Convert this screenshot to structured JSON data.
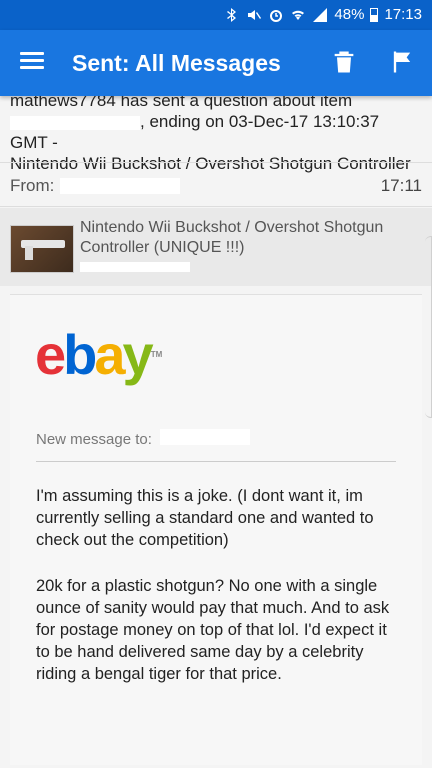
{
  "status_bar": {
    "battery_text": "48%",
    "battery_level": 0.48,
    "time": "17:13"
  },
  "app_bar": {
    "title": "Sent: All Messages"
  },
  "message": {
    "subject_partial_top": "mathews7784 has sent a question about item",
    "subject_partial_mid": ", ending on 03-Dec-17 13:10:37 GMT -",
    "subject_line_3": "Nintendo Wii Buckshot / Overshot Shotgun Controller",
    "from_label": "From:",
    "time": "17:11",
    "item_title": "Nintendo Wii Buckshot / Overshot Shotgun Controller (UNIQUE !!!)",
    "new_message_label": "New message to:",
    "body_paragraph_1": "I'm assuming this is a joke. (I dont want it, im currently selling a standard one and wanted to check out the competition)",
    "body_paragraph_2": "20k for a plastic shotgun? No one with a single ounce of sanity would pay that much. And to ask for postage money on top of that lol. I'd expect it to be hand delivered same day by a celebrity riding a bengal tiger for that price."
  },
  "ebay_logo": {
    "e": "e",
    "b": "b",
    "a": "a",
    "y": "y",
    "tm": "TM"
  },
  "icons": {
    "menu": "hamburger-icon",
    "trash": "trash-icon",
    "flag": "flag-icon"
  },
  "colors": {
    "app_bar": "#1976e0",
    "status_bar": "#0a62c9"
  }
}
